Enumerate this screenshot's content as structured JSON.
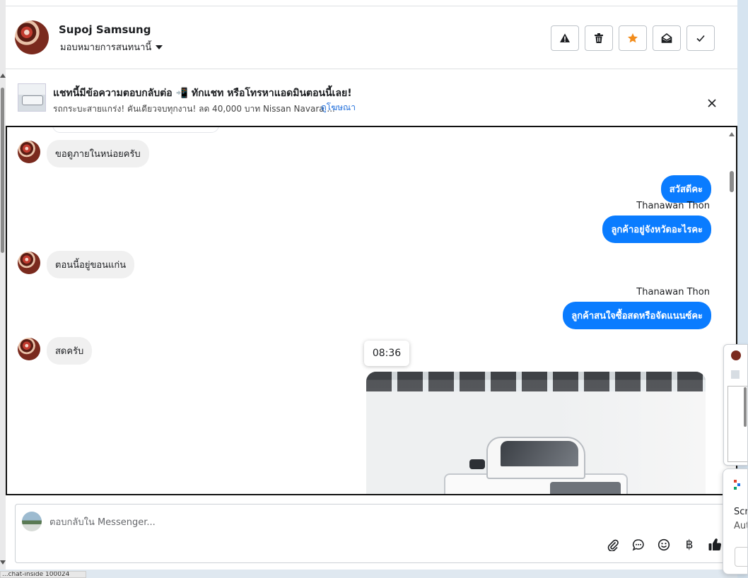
{
  "header": {
    "contact_name": "Supoj Samsung",
    "assign_label": "มอบหมายการสนทนานี้",
    "actions": [
      {
        "name": "report-button",
        "icon": "warning-icon"
      },
      {
        "name": "delete-button",
        "icon": "trash-icon"
      },
      {
        "name": "star-button",
        "icon": "star-icon",
        "color": "#f28c1b"
      },
      {
        "name": "mark-unread-button",
        "icon": "envelope-open-icon"
      },
      {
        "name": "mark-done-button",
        "icon": "check-icon"
      }
    ]
  },
  "banner": {
    "title": "แชทนี้มีข้อความตอบกลับต่อ 📲 ทักแชท หรือโทรหาแอดมินตอนนี้เลย!",
    "subtitle": "รถกระบะสายแกร่ง! คันเดียวจบทุกงาน! ลด 40,000 บาท Nissan Navara ...",
    "link": "ดูโฆษณา"
  },
  "messages": [
    {
      "type": "in",
      "text": "ขอดูภายในหน่อยครับ"
    },
    {
      "type": "out",
      "text": "สวัสดีคะ"
    },
    {
      "type": "out",
      "sender": "Thanawan Thon",
      "text": "ลูกค้าอยู่จังหวัดอะไรคะ"
    },
    {
      "type": "in",
      "text": "ตอนนี้อยู่ขอนแก่น"
    },
    {
      "type": "out",
      "sender": "Thanawan Thon",
      "text": "ลูกค้าสนใจซื้อสดหรือจัดแนนซ์คะ"
    },
    {
      "type": "in",
      "text": "สดครับ"
    }
  ],
  "time_tooltip": "08:36",
  "composer": {
    "placeholder": "ตอบกลับใน Messenger...",
    "tools": [
      "paperclip-icon",
      "chat-bubble-icon",
      "emoji-icon",
      "baht-icon",
      "thumbs-up-icon"
    ],
    "baht_glyph": "฿"
  },
  "notification": {
    "line1": "Scre",
    "line2": "Aut"
  },
  "status_tip": "...chat-inside 100024",
  "colors": {
    "accent": "#0a7cff",
    "link": "#216fdb",
    "star": "#f28c1b"
  }
}
